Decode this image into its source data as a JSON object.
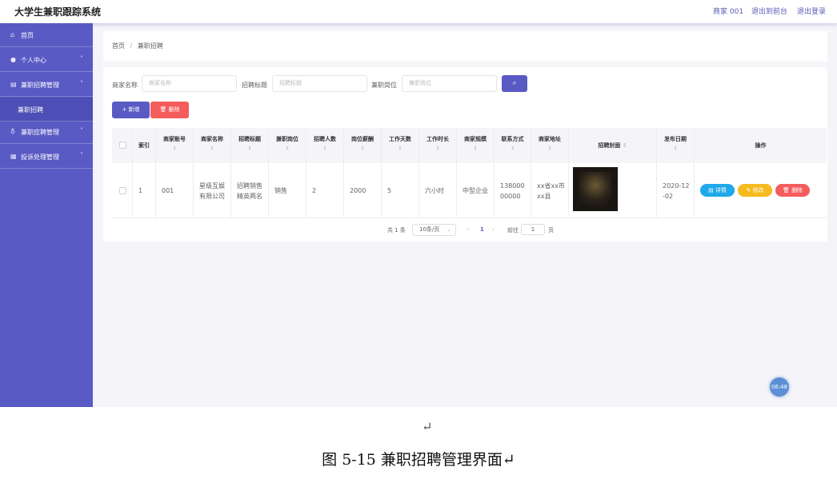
{
  "header": {
    "app_title": "大学生兼职跟踪系统",
    "user": "商家 001",
    "to_front": "退出到前台",
    "logout": "退出登录"
  },
  "sidebar": {
    "items": [
      {
        "icon": "home-icon",
        "label": "首页",
        "chevron": ""
      },
      {
        "icon": "user-icon",
        "label": "个人中心",
        "chevron": "˅"
      },
      {
        "icon": "briefcase-icon",
        "label": "兼职招聘管理",
        "chevron": "˄"
      },
      {
        "icon": "mic-icon",
        "label": "兼职应聘管理",
        "chevron": "˅"
      },
      {
        "icon": "grid-icon",
        "label": "投诉处理管理",
        "chevron": "˅"
      }
    ],
    "sub_item": "兼职招聘"
  },
  "breadcrumb": {
    "home": "首页",
    "sep": "/",
    "current": "兼职招聘"
  },
  "search": {
    "merchant_label": "商家名称",
    "merchant_placeholder": "商家名称",
    "title_label": "招聘标题",
    "title_placeholder": "招聘标题",
    "post_label": "兼职岗位",
    "post_placeholder": "兼职岗位",
    "search_icon": "search-icon"
  },
  "actions": {
    "add": "+ 新增",
    "delete": "删除"
  },
  "table": {
    "headers": [
      "索引",
      "商家账号",
      "商家名称",
      "招聘标题",
      "兼职岗位",
      "招聘人数",
      "岗位薪酬",
      "工作天数",
      "工作时长",
      "商家规模",
      "联系方式",
      "商家地址",
      "招聘封面",
      "发布日期",
      "操作"
    ],
    "sort_icon": "⇕",
    "rows": [
      {
        "index": "1",
        "account": "001",
        "name": "星级互娱有限公司",
        "title": "招聘销售精英两名",
        "post": "销售",
        "count": "2",
        "salary": "2000",
        "days": "5",
        "hours": "六小时",
        "scale": "中型企业",
        "phone": "13800000000",
        "address": "xx省xx市xx县",
        "date": "2020-12-02"
      }
    ],
    "row_actions": {
      "detail": "详情",
      "edit": "修改",
      "delete": "删除"
    }
  },
  "pagination": {
    "total": "共 1 条",
    "page_size": "10条/页",
    "current": "1",
    "goto": "前往",
    "goto_value": "1",
    "page_unit": "页"
  },
  "clock": "06:48",
  "paragraph_mark": "↵",
  "caption": "图 5-15 兼职招聘管理界面↵",
  "colors": {
    "primary": "#5a5ac4",
    "danger": "#f55d5d",
    "info": "#1ea9e9",
    "warning": "#f7ba1e"
  }
}
